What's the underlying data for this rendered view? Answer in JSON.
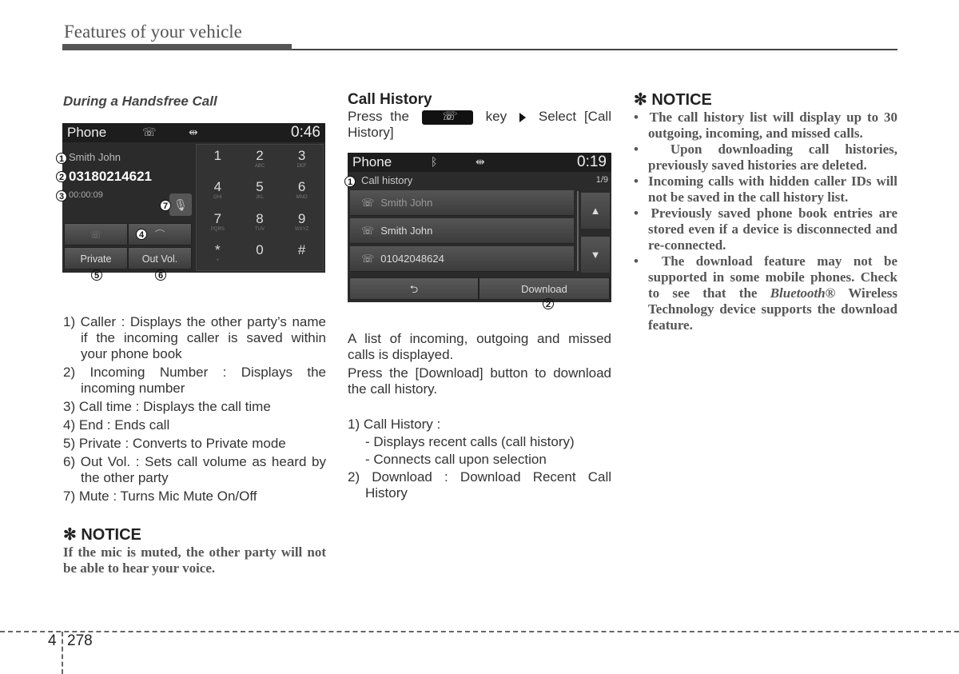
{
  "header": {
    "title": "Features of your vehicle"
  },
  "col1": {
    "subtitle": "During a Handsfree Call",
    "screen": {
      "title": "Phone",
      "clock": "0:46",
      "caller_name": "Smith John",
      "incoming_number": "03180214621",
      "call_time": "00:00:09",
      "private_label": "Private",
      "outvol_label": "Out Vol.",
      "keys": [
        {
          "d": "1",
          "s": ""
        },
        {
          "d": "2",
          "s": "ABC"
        },
        {
          "d": "3",
          "s": "DEF"
        },
        {
          "d": "4",
          "s": "GHI"
        },
        {
          "d": "5",
          "s": "JKL"
        },
        {
          "d": "6",
          "s": "MNO"
        },
        {
          "d": "7",
          "s": "PQRS"
        },
        {
          "d": "8",
          "s": "TUV"
        },
        {
          "d": "9",
          "s": "WXYZ"
        },
        {
          "d": "*",
          "s": "+"
        },
        {
          "d": "0",
          "s": ""
        },
        {
          "d": "#",
          "s": ""
        }
      ],
      "markers": [
        "1",
        "2",
        "3",
        "4",
        "5",
        "6",
        "7"
      ]
    },
    "items": [
      "1) Caller : Displays the other party’s name if the incoming caller is saved within your phone book",
      "2) Incoming Number : Displays the incoming number",
      "3) Call time : Displays the call time",
      "4) End : Ends call",
      "5) Private : Converts to Private mode",
      "6) Out Vol. : Sets call volume as heard by the other party",
      "7) Mute : Turns Mic Mute On/Off"
    ],
    "notice_title": "✻ NOTICE",
    "notice_text": "If the mic is muted, the other party will not be able to hear your voice."
  },
  "col2": {
    "title": "Call History",
    "instr_pre": "Press the",
    "instr_key": "key",
    "instr_post": "Select [Call History]",
    "screen": {
      "title": "Phone",
      "clock": "0:19",
      "list_title": "Call history",
      "page": "1/9",
      "rows": [
        "Smith John",
        "Smith John",
        "01042048624"
      ],
      "download_label": "Download",
      "markers": [
        "1",
        "2"
      ]
    },
    "para1": "A list of incoming, outgoing and missed calls is displayed.",
    "para2": "Press the [Download] button to download the call history.",
    "items": [
      "1) Call History :",
      "- Displays recent calls (call history)",
      "- Connects call upon selection",
      "2) Download : Download Recent Call History"
    ]
  },
  "col3": {
    "notice_title": "✻ NOTICE",
    "bullets": [
      "The call history list will display up to 30 outgoing, incoming, and missed calls.",
      "Upon downloading call histories, previously saved histories are deleted.",
      "Incoming calls with hidden caller IDs will not be saved in the call history list.",
      "Previously saved phone book entries are stored even if a device is disconnected and re-connected."
    ],
    "last_bullet_pre": "The download feature may not be supported in some mobile phones. Check to see that the",
    "last_bullet_brand": "Bluetooth®",
    "last_bullet_post": "Wireless Technology device supports the download feature."
  },
  "footer": {
    "chapter": "4",
    "page": "278"
  }
}
